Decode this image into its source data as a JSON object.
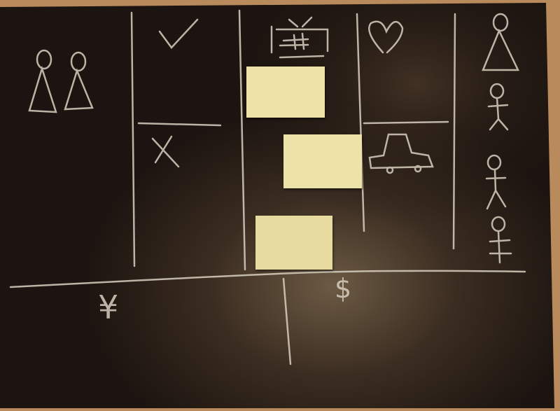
{
  "scene": {
    "colors": {
      "wall": "#b98a5c",
      "board": "#1c1410",
      "board_glare": "#5a4a38",
      "chalk": "#d8cfc0",
      "sticky_note": "#ede3a8"
    },
    "icons": [
      "two-female-figures-icon",
      "checkmark-icon",
      "cross-icon",
      "chinese-character-icon",
      "heart-icon",
      "car-icon",
      "stick-figures-column-icon"
    ],
    "symbols": {
      "yen": "¥",
      "dollar": "$"
    }
  }
}
